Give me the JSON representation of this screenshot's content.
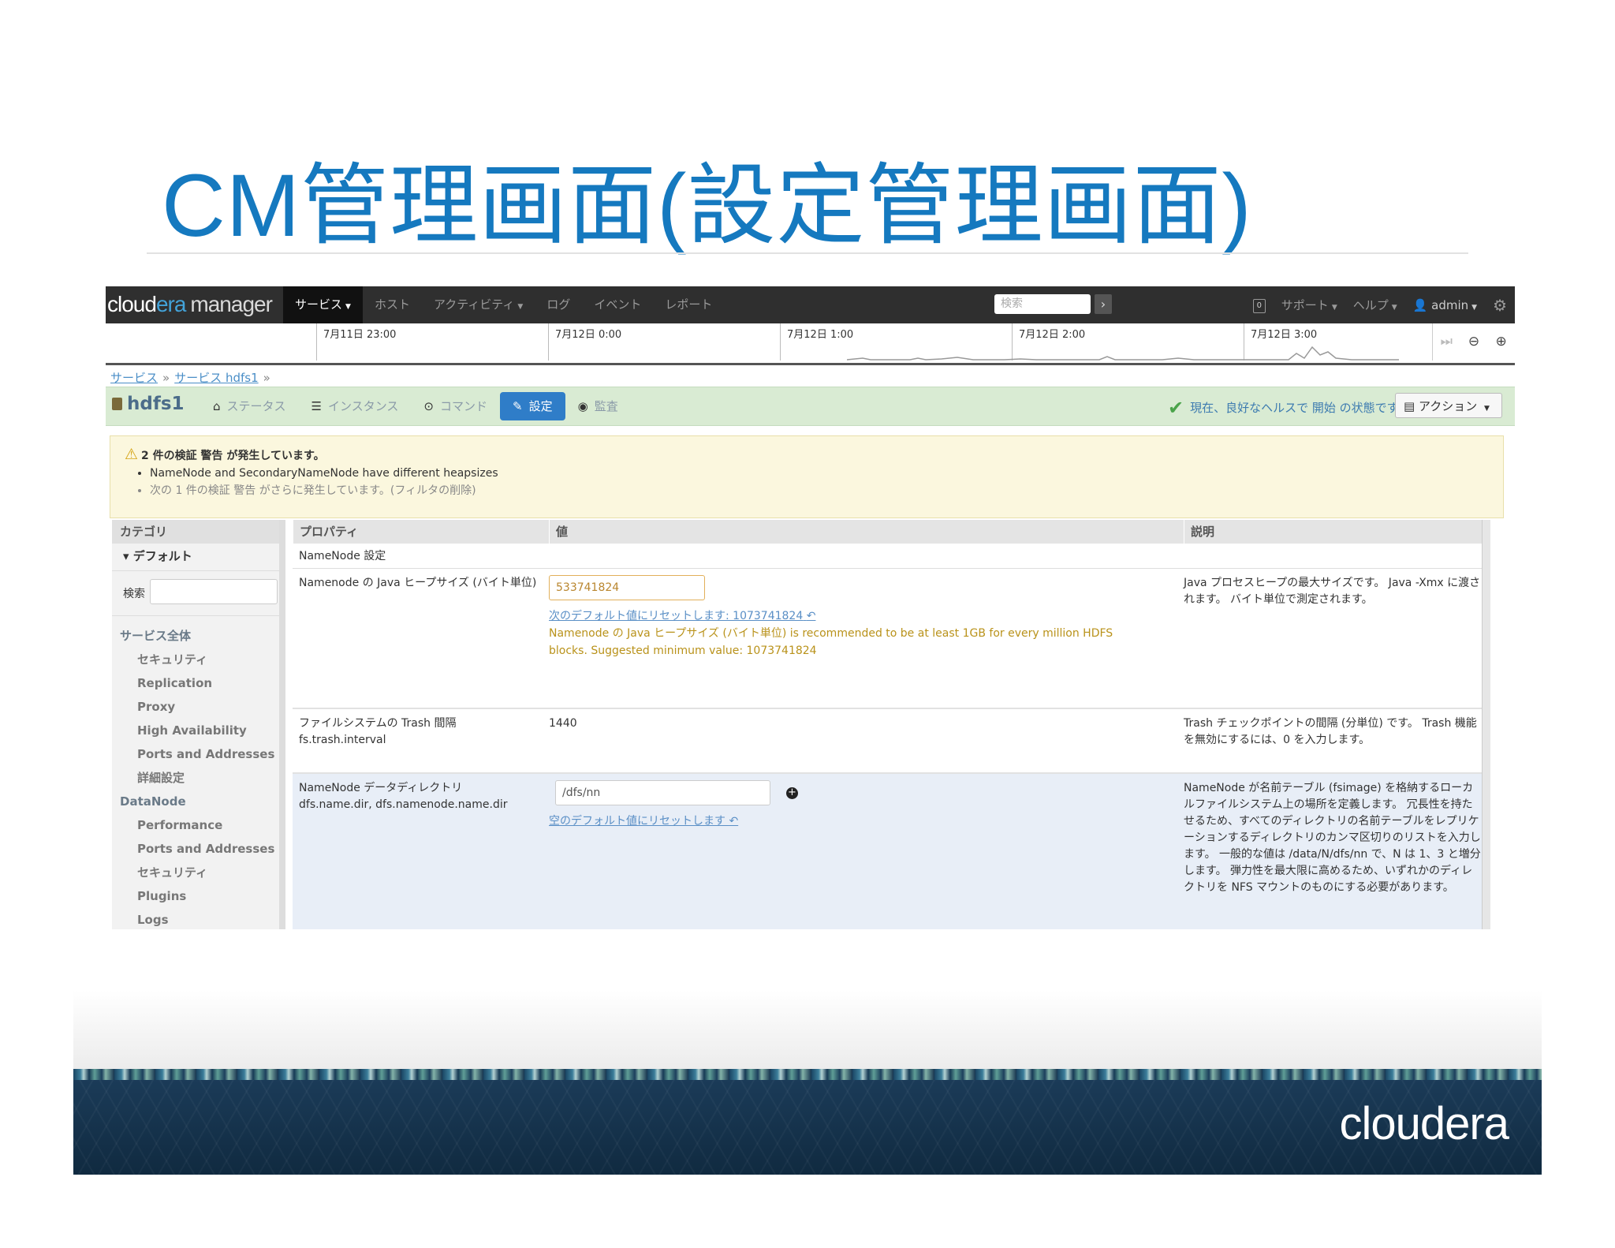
{
  "slide": {
    "title": "CM管理画面(設定管理画面)",
    "footer_logo": "cloudera"
  },
  "app": {
    "brand_a": "cloud",
    "brand_b": "era",
    "brand_c": "manager",
    "nav": [
      "サービス",
      "ホスト",
      "アクティビティ",
      "ログ",
      "イベント",
      "レポート"
    ],
    "search_placeholder": "検索",
    "support": "サポート",
    "help": "ヘルプ",
    "user": "admin"
  },
  "timeline": {
    "ticks": [
      "7月11日 23:00",
      "7月12日 0:00",
      "7月12日 1:00",
      "7月12日 2:00",
      "7月12日 3:00"
    ]
  },
  "breadcrumb": {
    "items": [
      "サービス",
      "サービス hdfs1"
    ]
  },
  "service": {
    "name": "hdfs1",
    "tabs": [
      "ステータス",
      "インスタンス",
      "コマンド",
      "設定",
      "監査"
    ],
    "health": "現在、良好なヘルスで 開始 の状態です",
    "actions": "アクション"
  },
  "warning": {
    "title": "2 件の検証 警告 が発生しています。",
    "items": [
      "NameNode and SecondaryNameNode have different heapsizes",
      "次の 1 件の検証 警告 がさらに発生しています。(フィルタの削除)"
    ]
  },
  "sidebar": {
    "header": "カテゴリ",
    "default": "デフォルト",
    "search_label": "検索",
    "items": [
      {
        "label": "サービス全体",
        "type": "group"
      },
      {
        "label": "セキュリティ",
        "type": "sub"
      },
      {
        "label": "Replication",
        "type": "sub"
      },
      {
        "label": "Proxy",
        "type": "sub"
      },
      {
        "label": "High Availability",
        "type": "sub"
      },
      {
        "label": "Ports and Addresses",
        "type": "sub"
      },
      {
        "label": "詳細設定",
        "type": "sub"
      },
      {
        "label": "DataNode",
        "type": "group"
      },
      {
        "label": "Performance",
        "type": "sub"
      },
      {
        "label": "Ports and Addresses",
        "type": "sub"
      },
      {
        "label": "セキュリティ",
        "type": "sub"
      },
      {
        "label": "Plugins",
        "type": "sub"
      },
      {
        "label": "Logs",
        "type": "sub"
      }
    ]
  },
  "table": {
    "headers": [
      "プロパティ",
      "値",
      "説明"
    ],
    "group": "NameNode 設定",
    "rows": [
      {
        "name": "Namenode の Java ヒープサイズ (バイト単位)",
        "value": "533741824",
        "reset": "次のデフォルト値にリセットします: 1073741824",
        "warning_line1": "Namenode の Java ヒープサイズ (バイト単位) is recommended to be at least 1GB for every million HDFS",
        "warning_line2": "blocks. Suggested minimum value: 1073741824",
        "desc": "Java プロセスヒープの最大サイズです。 Java -Xmx に渡されます。 バイト単位で測定されます。"
      },
      {
        "name": "ファイルシステムの Trash 間隔",
        "key": "fs.trash.interval",
        "value": "1440",
        "desc": "Trash チェックポイントの間隔 (分単位) です。 Trash 機能を無効にするには、0 を入力します。"
      },
      {
        "name": "NameNode データディレクトリ",
        "key": "dfs.name.dir, dfs.namenode.name.dir",
        "value": "/dfs/nn",
        "reset": "空のデフォルト値にリセットします",
        "desc": "NameNode が名前テーブル (fsimage) を格納するローカルファイルシステム上の場所を定義します。 冗長性を持たせるため、すべてのディレクトリの名前テーブルをレプリケーションするディレクトリのカンマ区切りのリストを入力します。 一般的な値は /data/N/dfs/nn で、N は 1、3 と増分します。 弾力性を最大限に高めるため、いずれかのディレクトリを NFS マウントのものにする必要があります。"
      }
    ]
  }
}
